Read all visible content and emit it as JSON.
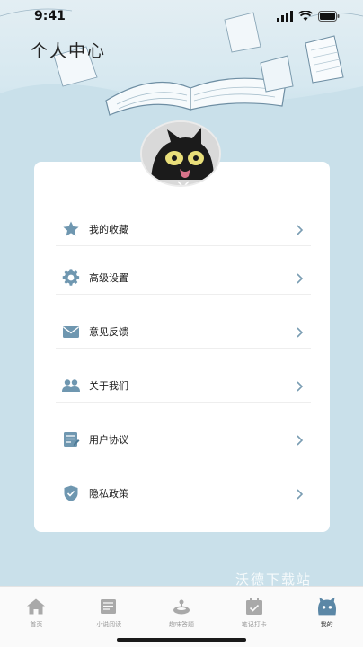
{
  "status_bar": {
    "time": "9:41"
  },
  "header": {
    "title": "个人中心"
  },
  "menu": {
    "items": [
      {
        "label": "我的收藏",
        "icon": "star-icon"
      },
      {
        "label": "高级设置",
        "icon": "gear-icon"
      },
      {
        "label": "意见反馈",
        "icon": "mail-icon"
      },
      {
        "label": "关于我们",
        "icon": "users-icon"
      },
      {
        "label": "用户协议",
        "icon": "document-icon"
      },
      {
        "label": "隐私政策",
        "icon": "shield-icon"
      }
    ]
  },
  "tabbar": {
    "tabs": [
      {
        "label": "首页",
        "icon": "home-icon",
        "active": false
      },
      {
        "label": "小说阅读",
        "icon": "book-icon",
        "active": false
      },
      {
        "label": "趣味答题",
        "icon": "quiz-icon",
        "active": false
      },
      {
        "label": "笔记打卡",
        "icon": "calendar-check-icon",
        "active": false
      },
      {
        "label": "我的",
        "icon": "cat-face-icon",
        "active": true
      }
    ]
  },
  "watermark": "沃德下载站",
  "colors": {
    "accent": "#6f97b0",
    "background": "#c9e0ea",
    "active_tab": "#5b87a6"
  }
}
